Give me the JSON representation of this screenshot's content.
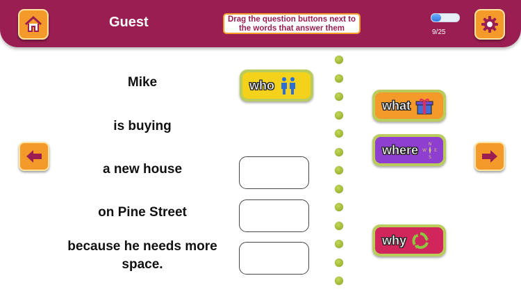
{
  "header": {
    "user_name": "Guest",
    "instruction": "Drag the question buttons next to the words that answer them",
    "progress": {
      "text": "9/25",
      "fraction": 0.36
    },
    "icons": {
      "home": "home-icon",
      "settings": "gear-icon"
    }
  },
  "phrases": [
    {
      "text": "Mike"
    },
    {
      "text": "is buying"
    },
    {
      "text": "a new house"
    },
    {
      "text": "on Pine Street"
    },
    {
      "text": "because he needs more space."
    }
  ],
  "question_buttons": [
    {
      "label": "who",
      "color": "#f4d21c",
      "icon": "people-icon"
    },
    {
      "label": "what",
      "color": "#f49a2a",
      "icon": "gift-icon"
    },
    {
      "label": "where",
      "color": "#8e3fd0",
      "icon": "compass-icon"
    },
    {
      "label": "why",
      "color": "#d0265c",
      "icon": "recycle-icon"
    }
  ],
  "nav": {
    "prev_icon": "arrow-left-icon",
    "next_icon": "arrow-right-icon"
  },
  "colors": {
    "header": "#9a1e52",
    "accent": "#f49a2a",
    "button_border": "#b9cc5c"
  }
}
